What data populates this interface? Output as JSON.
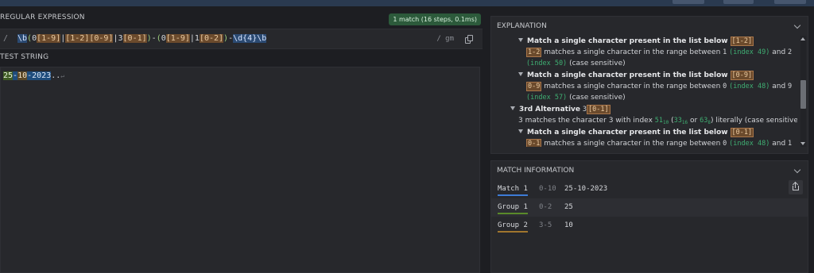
{
  "regex_section": {
    "title": "REGULAR EXPRESSION",
    "match_badge": "1 match (16 steps, 0.1ms)",
    "delimiter": "/",
    "flags": "/ gm",
    "tokens": [
      {
        "t": "\\b",
        "k": "esc"
      },
      {
        "t": "(",
        "k": "grp"
      },
      {
        "t": "0",
        "k": "alt"
      },
      {
        "t": "[1-9]",
        "k": "set"
      },
      {
        "t": "|",
        "k": "alt"
      },
      {
        "t": "[1-2]",
        "k": "set"
      },
      {
        "t": "[0-9]",
        "k": "set"
      },
      {
        "t": "|",
        "k": "alt"
      },
      {
        "t": "3",
        "k": "alt"
      },
      {
        "t": "[0-1]",
        "k": "set"
      },
      {
        "t": ")",
        "k": "grp"
      },
      {
        "t": "-",
        "k": "alt"
      },
      {
        "t": "(",
        "k": "grp"
      },
      {
        "t": "0",
        "k": "alt"
      },
      {
        "t": "[1-9]",
        "k": "set"
      },
      {
        "t": "|",
        "k": "alt"
      },
      {
        "t": "1",
        "k": "alt"
      },
      {
        "t": "[0-2]",
        "k": "set"
      },
      {
        "t": ")",
        "k": "grp"
      },
      {
        "t": "-",
        "k": "alt"
      },
      {
        "t": "\\d{4}",
        "k": "esc"
      },
      {
        "t": "\\b",
        "k": "esc"
      }
    ]
  },
  "test_section": {
    "title": "TEST STRING",
    "parts": [
      "25",
      "-",
      "10",
      "-2023",
      "..",
      "↵"
    ]
  },
  "explanation": {
    "title": "EXPLANATION",
    "l1_title": "Match a single character present in the list below",
    "l1_set": "[1-2]",
    "l2_tok": "1-2",
    "l2_a": "matches a single character in the range between",
    "l2_n1": "1",
    "l2_i1": "(index 49)",
    "l2_and": "and",
    "l2_n2": "2",
    "l3_i2": "(index 50)",
    "l3_cs": "(case sensitive)",
    "l4_title": "Match a single character present in the list below",
    "l4_set": "[0-9]",
    "l5_tok": "0-9",
    "l5_a": "matches a single character in the range between",
    "l5_n1": "0",
    "l5_i1": "(index 48)",
    "l5_and": "and",
    "l5_n2": "9",
    "l6_i2": "(index 57)",
    "l6_cs": "(case sensitive)",
    "l7_title": "3rd Alternative",
    "l7_tok": "3",
    "l7_set": "[0-1]",
    "l8_a": "3 matches the character 3 with index",
    "l8_dec": "51",
    "l8_dec_sub": "10",
    "l8_hex": "33",
    "l8_hex_sub": "16",
    "l8_or": "or",
    "l8_oct": "63",
    "l8_oct_sub": "8",
    "l8_b": ") literally (case sensitive)",
    "l9_title": "Match a single character present in the list below",
    "l9_set": "[0-1]",
    "l10_tok": "0-1",
    "l10_a": "matches a single character in the range between",
    "l10_n1": "0",
    "l10_i1": "(index 48)",
    "l10_and": "and",
    "l10_n2": "1"
  },
  "match_info": {
    "title": "MATCH INFORMATION",
    "rows": [
      {
        "label": "Match 1",
        "range": "0-10",
        "value": "25-10-2023",
        "color": "#3d7bd6"
      },
      {
        "label": "Group 1",
        "range": "0-2",
        "value": "25",
        "color": "#5a8a2a"
      },
      {
        "label": "Group 2",
        "range": "3-5",
        "value": "10",
        "color": "#a0762e"
      }
    ]
  },
  "colors": {
    "accent_match": "#3d7bd6",
    "badge_bg": "#2c5a3b",
    "set_bg": "#6b4a2c",
    "index_green": "#3fae72"
  }
}
